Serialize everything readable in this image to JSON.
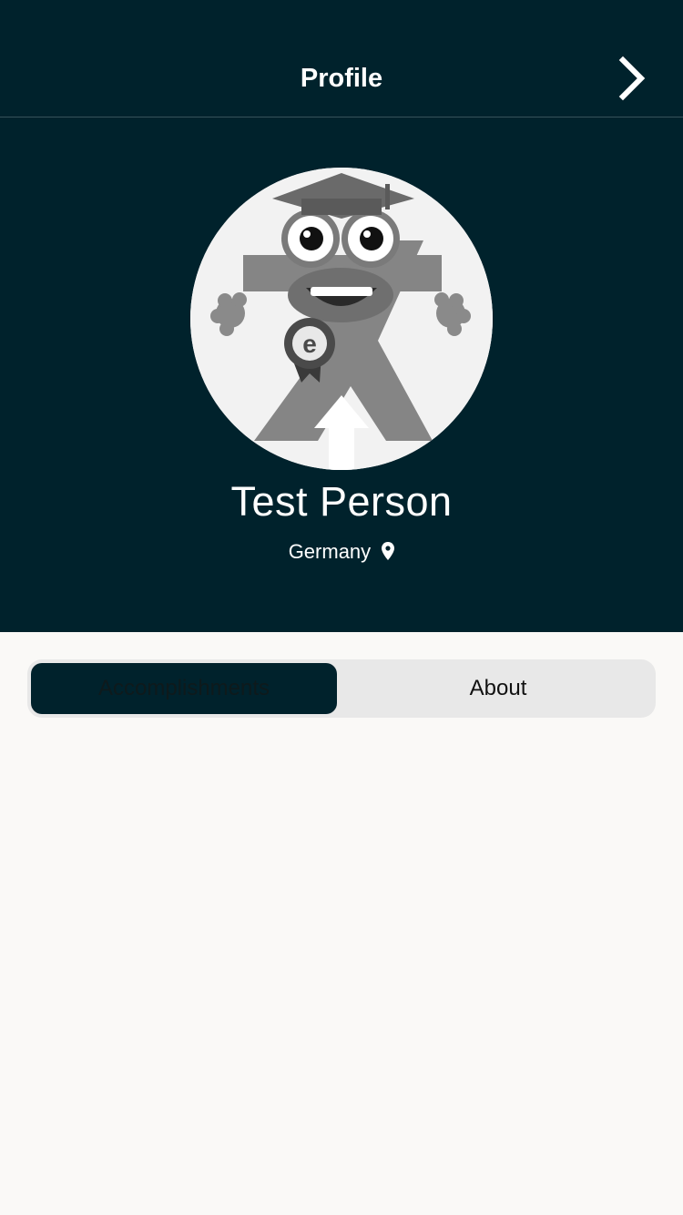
{
  "header": {
    "title": "Profile",
    "next_icon": "chevron-right-icon"
  },
  "profile": {
    "name": "Test Person",
    "location": "Germany",
    "location_icon": "map-pin-icon",
    "avatar_badge_letter": "e"
  },
  "tabs": {
    "items": [
      {
        "label": "Accomplishments",
        "selected": true
      },
      {
        "label": "About",
        "selected": false
      }
    ]
  },
  "colors": {
    "hero_background": "#00222c",
    "page_background": "#faf9f7",
    "segment_background": "#e8e8e8",
    "selected_segment": "#00222c"
  }
}
